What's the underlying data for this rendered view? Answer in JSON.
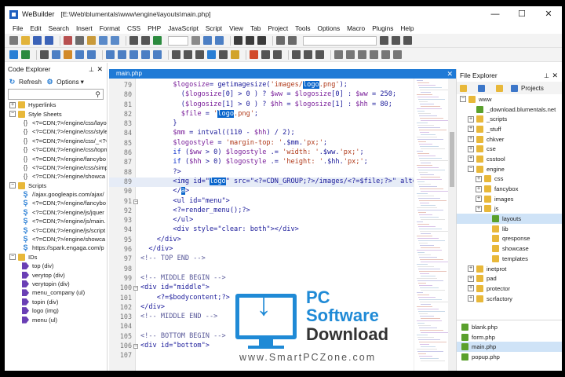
{
  "window": {
    "app_title": "WeBuilder",
    "path": "[E:\\Web\\blumentals\\www\\engine\\layouts\\main.php]",
    "minimize": "—",
    "maximize": "☐",
    "close": "✕"
  },
  "menu": [
    "File",
    "Edit",
    "Search",
    "Insert",
    "Format",
    "CSS",
    "PHP",
    "JavaScript",
    "Script",
    "View",
    "Tab",
    "Project",
    "Tools",
    "Options",
    "Macro",
    "Plugins",
    "Help"
  ],
  "code_explorer": {
    "title": "Code Explorer",
    "refresh": "Refresh",
    "options": "Options",
    "items": [
      {
        "level": 1,
        "exp": "+",
        "icon": "folder",
        "label": "Hyperlinks"
      },
      {
        "level": 1,
        "exp": "−",
        "icon": "folder",
        "label": "Style Sheets"
      },
      {
        "level": 2,
        "icon": "brace",
        "label": "<?=CDN;?>/engine/css/layo"
      },
      {
        "level": 2,
        "icon": "brace",
        "label": "<?=CDN;?>/engine/css/style"
      },
      {
        "level": 2,
        "icon": "brace",
        "label": "<?=CDN;?>/engine/css/_<?="
      },
      {
        "level": 2,
        "icon": "brace",
        "label": "<?=CDN;?>/engine/css/topn"
      },
      {
        "level": 2,
        "icon": "brace",
        "label": "<?=CDN;?>/engine/fancybo"
      },
      {
        "level": 2,
        "icon": "brace",
        "label": "<?=CDN;?>/engine/css/simp"
      },
      {
        "level": 2,
        "icon": "brace",
        "label": "<?=CDN;?>/engine/showca"
      },
      {
        "level": 1,
        "exp": "−",
        "icon": "folder",
        "label": "Scripts"
      },
      {
        "level": 2,
        "icon": "s",
        "label": "//ajax.googleapis.com/ajax/"
      },
      {
        "level": 2,
        "icon": "s",
        "label": "<?=CDN;?>/engine/fancybo"
      },
      {
        "level": 2,
        "icon": "s",
        "label": "<?=CDN;?>/engine/js/jquer"
      },
      {
        "level": 2,
        "icon": "s",
        "label": "<?=CDN;?>/engine/js/main."
      },
      {
        "level": 2,
        "icon": "s",
        "label": "<?=CDN;?>/engine/js/script"
      },
      {
        "level": 2,
        "icon": "s",
        "label": "<?=CDN;?>/engine/showca"
      },
      {
        "level": 2,
        "icon": "s",
        "label": "https://spark.engaga.com/p"
      },
      {
        "level": 1,
        "exp": "−",
        "icon": "folder",
        "label": "IDs"
      },
      {
        "level": 2,
        "icon": "tag",
        "label": "top (div)"
      },
      {
        "level": 2,
        "icon": "tag",
        "label": "verytop (div)"
      },
      {
        "level": 2,
        "icon": "tag",
        "label": "verytopin (div)"
      },
      {
        "level": 2,
        "icon": "tag",
        "label": "menu_company (ul)"
      },
      {
        "level": 2,
        "icon": "tag",
        "label": "topin (div)"
      },
      {
        "level": 2,
        "icon": "tag",
        "label": "logo (img)"
      },
      {
        "level": 2,
        "icon": "tag",
        "label": "menu (ul)"
      }
    ]
  },
  "editor": {
    "tab": "main.php",
    "lines": [
      {
        "n": "79",
        "segs": [
          [
            "i",
            "        "
          ],
          [
            "v",
            "$logosize"
          ],
          [
            "",
            "= getimagesize("
          ],
          [
            "s",
            "'images/"
          ],
          [
            "sel",
            "logo"
          ],
          [
            "s",
            ".png'"
          ],
          [
            "",
            ");"
          ]
        ]
      },
      {
        "n": "80",
        "segs": [
          [
            "i",
            "          "
          ],
          [
            "",
            "("
          ],
          [
            "v",
            "$logosize"
          ],
          [
            "",
            "[0] > 0 ) ? "
          ],
          [
            "v",
            "$ww"
          ],
          [
            "",
            " = "
          ],
          [
            "v",
            "$logosize"
          ],
          [
            "",
            "[0] : "
          ],
          [
            "v",
            "$ww"
          ],
          [
            "",
            " = 250;"
          ]
        ]
      },
      {
        "n": "81",
        "segs": [
          [
            "i",
            "          "
          ],
          [
            "",
            "("
          ],
          [
            "v",
            "$logosize"
          ],
          [
            "",
            "[1] > 0 ) ? "
          ],
          [
            "v",
            "$hh"
          ],
          [
            "",
            " = "
          ],
          [
            "v",
            "$logosize"
          ],
          [
            "",
            "[1] : "
          ],
          [
            "v",
            "$hh"
          ],
          [
            "",
            " = 80;"
          ]
        ]
      },
      {
        "n": "82",
        "segs": [
          [
            "i",
            "          "
          ],
          [
            "v",
            "$file"
          ],
          [
            "",
            " = "
          ],
          [
            "s",
            "'"
          ],
          [
            "sel",
            "logo"
          ],
          [
            "s",
            ".png'"
          ],
          [
            "",
            ";"
          ]
        ]
      },
      {
        "n": "83",
        "segs": [
          [
            "i",
            "        "
          ],
          [
            "",
            "}"
          ]
        ]
      },
      {
        "n": "84",
        "segs": [
          [
            "i",
            "        "
          ],
          [
            "v",
            "$mm"
          ],
          [
            "",
            " = intval((110 - "
          ],
          [
            "v",
            "$hh"
          ],
          [
            "",
            ") / 2);"
          ]
        ]
      },
      {
        "n": "85",
        "segs": [
          [
            "i",
            "        "
          ],
          [
            "v",
            "$logostyle"
          ],
          [
            "",
            " = "
          ],
          [
            "s",
            "'margin-top: '"
          ],
          [
            "",
            ".$mm."
          ],
          [
            "s",
            "'px;'"
          ],
          [
            "",
            ";"
          ]
        ]
      },
      {
        "n": "86",
        "segs": [
          [
            "i",
            "        "
          ],
          [
            "k",
            "if"
          ],
          [
            "",
            " ("
          ],
          [
            "v",
            "$ww"
          ],
          [
            "",
            " > 0) "
          ],
          [
            "v",
            "$logostyle"
          ],
          [
            "",
            " .= "
          ],
          [
            "s",
            "'width: '"
          ],
          [
            "",
            ".$ww."
          ],
          [
            "s",
            "'px;'"
          ],
          [
            "",
            ";"
          ]
        ]
      },
      {
        "n": "87",
        "segs": [
          [
            "i",
            "        "
          ],
          [
            "k",
            "if"
          ],
          [
            "",
            " ("
          ],
          [
            "v",
            "$hh"
          ],
          [
            "",
            " > 0) "
          ],
          [
            "v",
            "$logostyle"
          ],
          [
            "",
            " .= "
          ],
          [
            "s",
            "'height: '"
          ],
          [
            "",
            ".$hh."
          ],
          [
            "s",
            "'px;'"
          ],
          [
            "",
            ";"
          ]
        ]
      },
      {
        "n": "88",
        "segs": [
          [
            "i",
            "        "
          ],
          [
            "",
            "?>"
          ]
        ]
      },
      {
        "n": "89",
        "hl": true,
        "segs": [
          [
            "i",
            "        "
          ],
          [
            "",
            "<img id=\""
          ],
          [
            "sel",
            "logo"
          ],
          [
            "",
            "\" src=\"<?=CDN_GROUP;?>/images/<?=$file;?>\" alt=\""
          ]
        ]
      },
      {
        "n": "90",
        "segs": [
          [
            "i",
            "        "
          ],
          [
            "",
            "</"
          ],
          [
            "sel",
            "a"
          ],
          [
            "",
            ">"
          ]
        ]
      },
      {
        "n": "91",
        "fold": "−",
        "segs": [
          [
            "i",
            "        "
          ],
          [
            "",
            "<ul id=\"menu\">"
          ]
        ]
      },
      {
        "n": "92",
        "segs": [
          [
            "i",
            "        "
          ],
          [
            "",
            "<?=render_menu();?>"
          ]
        ]
      },
      {
        "n": "93",
        "segs": [
          [
            "i",
            "        "
          ],
          [
            "",
            "</ul>"
          ]
        ]
      },
      {
        "n": "94",
        "segs": [
          [
            "i",
            "        "
          ],
          [
            "",
            "<div style=\"clear: both\"></div>"
          ]
        ]
      },
      {
        "n": "95",
        "segs": [
          [
            "i",
            "    "
          ],
          [
            "",
            "</div>"
          ]
        ]
      },
      {
        "n": "96",
        "segs": [
          [
            "i",
            "  "
          ],
          [
            "",
            "</div>"
          ]
        ]
      },
      {
        "n": "97",
        "segs": [
          [
            "c",
            "<!-- TOP END -->"
          ]
        ]
      },
      {
        "n": "98",
        "segs": [
          [
            "",
            ""
          ]
        ]
      },
      {
        "n": "99",
        "segs": [
          [
            "c",
            "<!-- MIDDLE BEGIN -->"
          ]
        ]
      },
      {
        "n": "100",
        "fold": "−",
        "segs": [
          [
            "",
            "<div id=\"middle\">"
          ]
        ]
      },
      {
        "n": "101",
        "segs": [
          [
            "i",
            "    "
          ],
          [
            "",
            "<?=$bodycontent;?>"
          ]
        ]
      },
      {
        "n": "102",
        "segs": [
          [
            "",
            "</div>"
          ]
        ]
      },
      {
        "n": "103",
        "segs": [
          [
            "c",
            "<!-- MIDDLE END -->"
          ]
        ]
      },
      {
        "n": "104",
        "segs": [
          [
            "",
            ""
          ]
        ]
      },
      {
        "n": "105",
        "segs": [
          [
            "c",
            "<!-- BOTTOM BEGIN -->"
          ]
        ]
      },
      {
        "n": "106",
        "fold": "−",
        "segs": [
          [
            "",
            "<div id=\"bottom\">"
          ]
        ]
      },
      {
        "n": "107",
        "segs": [
          [
            "",
            ""
          ]
        ]
      }
    ]
  },
  "file_explorer": {
    "title": "File Explorer",
    "projects": "Projects",
    "items": [
      {
        "level": 0,
        "exp": "−",
        "icon": "folder",
        "label": "www"
      },
      {
        "level": 1,
        "icon": "green",
        "label": "_download.blumentals.net"
      },
      {
        "level": 1,
        "exp": "+",
        "icon": "folder",
        "label": "_scripts"
      },
      {
        "level": 1,
        "exp": "+",
        "icon": "folder",
        "label": "_stuff"
      },
      {
        "level": 1,
        "exp": "+",
        "icon": "folder",
        "label": "chkver"
      },
      {
        "level": 1,
        "exp": "+",
        "icon": "folder",
        "label": "cse"
      },
      {
        "level": 1,
        "exp": "+",
        "icon": "folder",
        "label": "csstool"
      },
      {
        "level": 1,
        "exp": "−",
        "icon": "folder",
        "label": "engine"
      },
      {
        "level": 2,
        "exp": "+",
        "icon": "folder",
        "label": "css"
      },
      {
        "level": 2,
        "exp": "+",
        "icon": "folder",
        "label": "fancybox"
      },
      {
        "level": 2,
        "exp": "+",
        "icon": "folder",
        "label": "images"
      },
      {
        "level": 2,
        "exp": "+",
        "icon": "folder",
        "label": "js"
      },
      {
        "level": 3,
        "icon": "green",
        "label": "layouts",
        "sel": true
      },
      {
        "level": 3,
        "icon": "folder",
        "label": "lib"
      },
      {
        "level": 3,
        "icon": "folder",
        "label": "qresponse"
      },
      {
        "level": 3,
        "icon": "folder",
        "label": "showcase"
      },
      {
        "level": 3,
        "icon": "folder",
        "label": "templates"
      },
      {
        "level": 1,
        "exp": "+",
        "icon": "folder",
        "label": "inetprot"
      },
      {
        "level": 1,
        "exp": "+",
        "icon": "folder",
        "label": "pad"
      },
      {
        "level": 1,
        "exp": "+",
        "icon": "folder",
        "label": "protector"
      },
      {
        "level": 1,
        "exp": "+",
        "icon": "folder",
        "label": "scrfactory"
      }
    ],
    "files": [
      {
        "label": "blank.php"
      },
      {
        "label": "form.php"
      },
      {
        "label": "main.php",
        "sel": true
      },
      {
        "label": "popup.php"
      }
    ]
  },
  "watermark": {
    "pc": "PC",
    "software": "Software",
    "download": "Download",
    "url": "www.SmartPCZone.com"
  }
}
